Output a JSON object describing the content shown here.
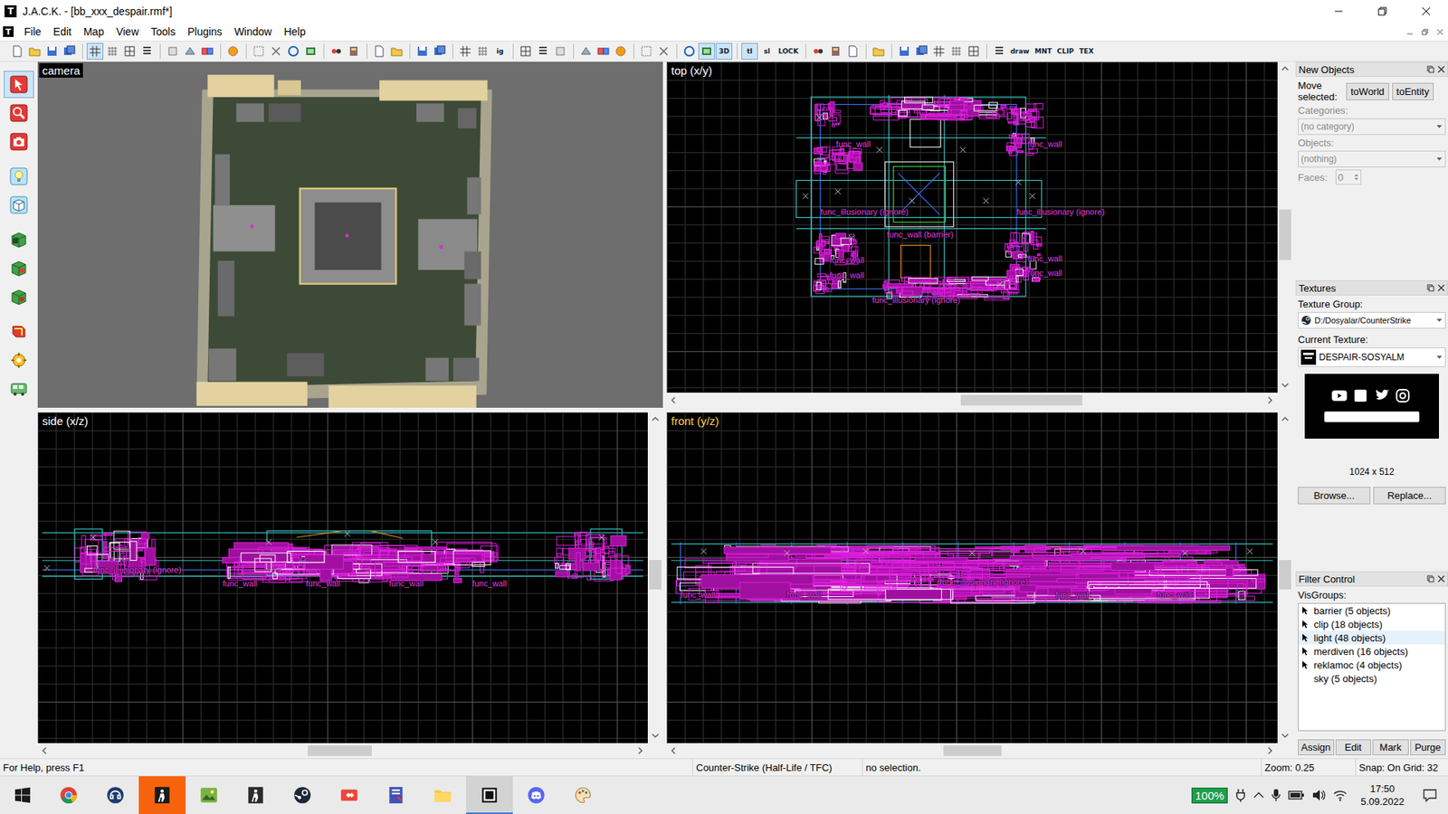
{
  "window": {
    "icon": "T",
    "title": "J.A.C.K. - [bb_xxx_despair.rmf*]"
  },
  "menu": {
    "icon": "T",
    "items": [
      "File",
      "Edit",
      "Map",
      "View",
      "Tools",
      "Plugins",
      "Window",
      "Help"
    ]
  },
  "toolbar": [
    {
      "kind": "icon",
      "pressed": false
    },
    {
      "kind": "icon",
      "pressed": false
    },
    {
      "kind": "icon",
      "pressed": false
    },
    {
      "kind": "icon",
      "pressed": false
    },
    {
      "kind": "sep"
    },
    {
      "kind": "icon",
      "pressed": true
    },
    {
      "kind": "icon",
      "pressed": false
    },
    {
      "kind": "icon",
      "pressed": false
    },
    {
      "kind": "icon",
      "pressed": false
    },
    {
      "kind": "sep"
    },
    {
      "kind": "icon",
      "pressed": false
    },
    {
      "kind": "icon",
      "pressed": false
    },
    {
      "kind": "icon",
      "pressed": false
    },
    {
      "kind": "sep"
    },
    {
      "kind": "icon",
      "pressed": false
    },
    {
      "kind": "sep"
    },
    {
      "kind": "icon",
      "pressed": false
    },
    {
      "kind": "icon",
      "pressed": false
    },
    {
      "kind": "icon",
      "pressed": false
    },
    {
      "kind": "icon",
      "pressed": false
    },
    {
      "kind": "sep"
    },
    {
      "kind": "icon",
      "pressed": false
    },
    {
      "kind": "icon",
      "pressed": false
    },
    {
      "kind": "sep"
    },
    {
      "kind": "icon",
      "pressed": false
    },
    {
      "kind": "icon",
      "pressed": false
    },
    {
      "kind": "sep"
    },
    {
      "kind": "icon",
      "pressed": false
    },
    {
      "kind": "icon",
      "pressed": false
    },
    {
      "kind": "sep"
    },
    {
      "kind": "icon",
      "pressed": false
    },
    {
      "kind": "icon",
      "pressed": false
    },
    {
      "kind": "text",
      "label": "ig",
      "pressed": false
    },
    {
      "kind": "sep"
    },
    {
      "kind": "icon",
      "pressed": false
    },
    {
      "kind": "icon",
      "pressed": false
    },
    {
      "kind": "icon",
      "pressed": false
    },
    {
      "kind": "sep"
    },
    {
      "kind": "icon",
      "pressed": false
    },
    {
      "kind": "icon",
      "pressed": false
    },
    {
      "kind": "icon",
      "pressed": false
    },
    {
      "kind": "sep"
    },
    {
      "kind": "icon",
      "pressed": false
    },
    {
      "kind": "icon",
      "pressed": false
    },
    {
      "kind": "sep"
    },
    {
      "kind": "icon",
      "pressed": false
    },
    {
      "kind": "icon",
      "pressed": true
    },
    {
      "kind": "text",
      "label": "3D",
      "pressed": true
    },
    {
      "kind": "sep"
    },
    {
      "kind": "text",
      "label": "tl",
      "pressed": true
    },
    {
      "kind": "text",
      "label": "sl",
      "pressed": false
    },
    {
      "kind": "text",
      "label": "LOCK",
      "pressed": false
    },
    {
      "kind": "sep"
    },
    {
      "kind": "icon",
      "pressed": false
    },
    {
      "kind": "icon",
      "pressed": false
    },
    {
      "kind": "icon",
      "pressed": false
    },
    {
      "kind": "sep"
    },
    {
      "kind": "icon",
      "pressed": false
    },
    {
      "kind": "sep"
    },
    {
      "kind": "icon",
      "pressed": false
    },
    {
      "kind": "icon",
      "pressed": false
    },
    {
      "kind": "icon",
      "pressed": false
    },
    {
      "kind": "icon",
      "pressed": false
    },
    {
      "kind": "icon",
      "pressed": false
    },
    {
      "kind": "sep"
    },
    {
      "kind": "icon",
      "pressed": false
    },
    {
      "kind": "text",
      "label": "draw",
      "pressed": false
    },
    {
      "kind": "text",
      "label": "MNT",
      "pressed": false
    },
    {
      "kind": "text",
      "label": "CLIP",
      "pressed": false
    },
    {
      "kind": "text",
      "label": "TEX",
      "pressed": false
    }
  ],
  "tools": [
    {
      "selected": true
    },
    {
      "selected": false
    },
    {
      "selected": false
    },
    {
      "selected": false
    },
    {
      "selected": false
    },
    {
      "selected": false
    },
    {
      "selected": false
    },
    {
      "selected": false
    },
    {
      "selected": false
    },
    {
      "selected": false
    },
    {
      "selected": false
    }
  ],
  "viewports": [
    {
      "label": "camera",
      "kind": "camera",
      "active": false
    },
    {
      "label": "top (x/y)",
      "kind": "top",
      "active": false,
      "entities": [
        "func_wall",
        "func_wall",
        "func_illusionary (ignore)",
        "func_wall (barrier)",
        "func_illusionary (ignore)",
        "func_wall",
        "func_wall",
        "func_wall",
        "func_wall",
        "func_illusionary (ignore)"
      ],
      "hscroll": {
        "start": 0.48,
        "end": 0.69
      },
      "vscroll": {
        "start": 0.44,
        "end": 0.61
      }
    },
    {
      "label": "side (x/z)",
      "kind": "side",
      "active": false,
      "entities": [
        "func_illusionary (ignore)",
        "func_wall",
        "func_wall",
        "func_wall",
        "func_wall"
      ],
      "hscroll": {
        "start": 0.44,
        "end": 0.55
      },
      "vscroll": {
        "start": 0.44,
        "end": 0.54
      }
    },
    {
      "label": "front (y/z)",
      "kind": "front",
      "active": true,
      "entities": [
        "func_wall",
        "func_wall",
        "func_illusionary (ignore)",
        "func_wall",
        "func_wall"
      ],
      "hscroll": {
        "start": 0.45,
        "end": 0.55
      },
      "vscroll": {
        "start": 0.44,
        "end": 0.54
      }
    }
  ],
  "panels": {
    "new_objects": {
      "title": "New Objects",
      "move_label": "Move selected:",
      "buttons": [
        "toWorld",
        "toEntity"
      ],
      "categories_label": "Categories:",
      "categories": {
        "value": "(no category)",
        "disabled": true
      },
      "objects_label": "Objects:",
      "objects": {
        "value": "(nothing)",
        "disabled": true
      },
      "faces_label": "Faces:",
      "faces": {
        "value": "0",
        "disabled": true
      }
    },
    "textures": {
      "title": "Textures",
      "group_label": "Texture Group:",
      "group": "D:/Dosyalar/CounterStrike",
      "current_label": "Current Texture:",
      "current": "DESPAIR-SOSYALM",
      "size": "1024 x 512",
      "buttons": [
        "Browse...",
        "Replace..."
      ]
    },
    "filter": {
      "title": "Filter Control",
      "visgroups_label": "VisGroups:",
      "visgroups": [
        {
          "label": "barrier (5 objects)",
          "visible": true,
          "selected": false
        },
        {
          "label": "clip (18 objects)",
          "visible": true,
          "selected": false
        },
        {
          "label": "light (48 objects)",
          "visible": true,
          "selected": true
        },
        {
          "label": "merdiven (16 objects)",
          "visible": true,
          "selected": false
        },
        {
          "label": "reklamoc (4 objects)",
          "visible": true,
          "selected": false
        },
        {
          "label": "sky (5 objects)",
          "visible": false,
          "selected": false
        }
      ],
      "buttons": [
        "Assign",
        "Edit",
        "Mark",
        "Purge"
      ]
    }
  },
  "status_bar": [
    "For Help, press F1",
    "Counter-Strike (Half-Life / TFC)",
    "no selection.",
    "Zoom: 0.25",
    "Snap: On Grid: 32"
  ],
  "taskbar": {
    "apps": [
      {
        "selected": false,
        "flashing": false
      },
      {
        "selected": false,
        "flashing": false
      },
      {
        "selected": false,
        "flashing": true
      },
      {
        "selected": false,
        "flashing": false
      },
      {
        "selected": false,
        "flashing": false
      },
      {
        "selected": false,
        "flashing": false
      },
      {
        "selected": false,
        "flashing": false
      },
      {
        "selected": false,
        "flashing": false
      },
      {
        "selected": false,
        "flashing": false
      },
      {
        "selected": true,
        "flashing": false
      },
      {
        "selected": false,
        "flashing": false
      },
      {
        "selected": false,
        "flashing": false
      }
    ],
    "battery": "100%",
    "time": "17:50",
    "date": "5.09.2022"
  }
}
